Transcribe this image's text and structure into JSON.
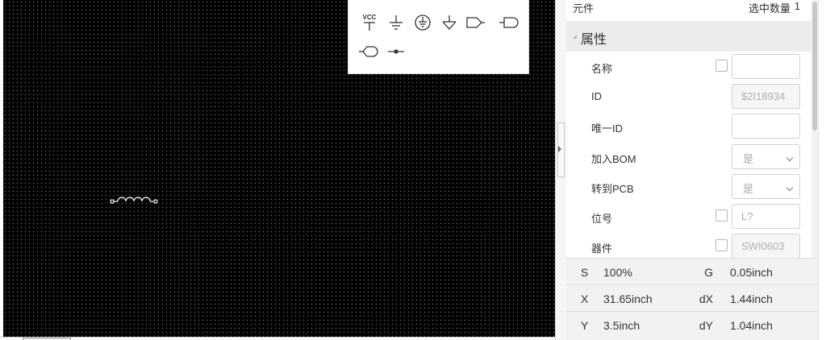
{
  "palette": {
    "icons": [
      {
        "name": "vcc-symbol-icon",
        "text": "VCC"
      },
      {
        "name": "ground-symbol-icon"
      },
      {
        "name": "protective-earth-icon"
      },
      {
        "name": "analog-ground-icon"
      },
      {
        "name": "netport-output-icon"
      },
      {
        "name": "netport-input-icon"
      },
      {
        "name": "netport-bidirectional-icon"
      },
      {
        "name": "net-label-icon"
      }
    ]
  },
  "panel": {
    "title": "元件",
    "selection_count_label": "选中数量",
    "selection_count_value": "1",
    "section_title": "属性",
    "properties": [
      {
        "label": "名称",
        "value": "",
        "placeholder": ""
      },
      {
        "label": "ID",
        "value": "$2I18934"
      },
      {
        "label": "唯一ID",
        "value": ""
      },
      {
        "label": "加入BOM",
        "value": "是"
      },
      {
        "label": "转到PCB",
        "value": "是"
      },
      {
        "label": "位号",
        "placeholder": "L?"
      },
      {
        "label": "器件",
        "value": "SWI0603"
      }
    ]
  },
  "status": {
    "scale_key": "S",
    "scale_value": "100%",
    "grid_key": "G",
    "grid_value": "0.05inch",
    "x_key": "X",
    "x_value": "31.65inch",
    "dx_key": "dX",
    "dx_value": "1.44inch",
    "y_key": "Y",
    "y_value": "3.5inch",
    "dy_key": "dY",
    "dy_value": "1.04inch"
  },
  "colors": {
    "canvas_bg": "#000000",
    "grid_dot": "#5a5a5a",
    "component_stroke": "#ffffff"
  }
}
